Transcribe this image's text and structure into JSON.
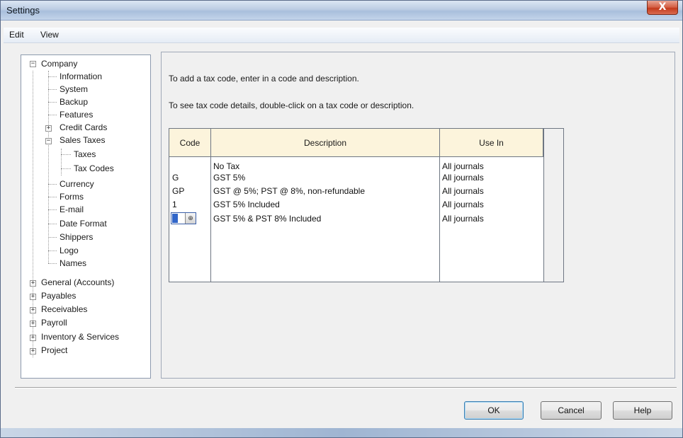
{
  "window": {
    "title": "Settings",
    "close_glyph": "X"
  },
  "menu": [
    "Edit",
    "View"
  ],
  "tree": {
    "company": "Company",
    "company_children": [
      "Information",
      "System",
      "Backup",
      "Features",
      "Credit Cards",
      "Sales Taxes"
    ],
    "sales_taxes_children": [
      "Taxes",
      "Tax Codes"
    ],
    "company_children_after": [
      "Currency",
      "Forms",
      "E-mail",
      "Date Format",
      "Shippers",
      "Logo",
      "Names"
    ],
    "roots": [
      "General (Accounts)",
      "Payables",
      "Receivables",
      "Payroll",
      "Inventory & Services",
      "Project"
    ],
    "expander_minus": "−",
    "expander_plus": "+"
  },
  "panel": {
    "instruction_1": "To add a tax code, enter in a code and description.",
    "instruction_2": "To see tax code details, double-click on a tax code or description."
  },
  "table": {
    "headers": {
      "code": "Code",
      "description": "Description",
      "use_in": "Use In"
    },
    "rows": [
      {
        "code": "",
        "description": "No Tax",
        "use_in": "All journals"
      },
      {
        "code": "G",
        "description": "GST 5%",
        "use_in": "All journals"
      },
      {
        "code": "GP",
        "description": "GST @ 5%; PST @ 8%, non-refundable",
        "use_in": "All journals"
      },
      {
        "code": "1",
        "description": "GST 5% Included",
        "use_in": "All journals"
      },
      {
        "code": "",
        "description": "GST 5% & PST 8% Included",
        "use_in": "All journals"
      }
    ],
    "lookup_glyph": "⊕"
  },
  "buttons": {
    "ok": "OK",
    "cancel": "Cancel",
    "help": "Help"
  }
}
